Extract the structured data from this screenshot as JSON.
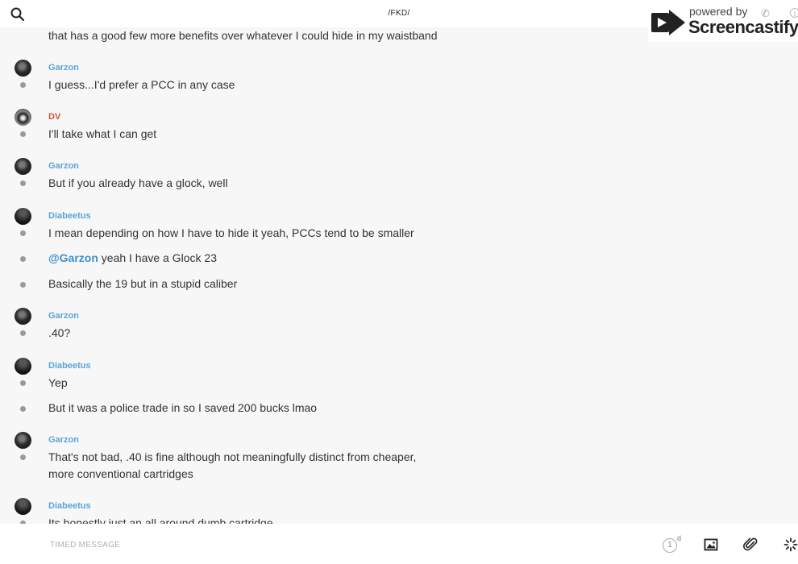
{
  "header": {
    "title": "/FKD/",
    "search_icon": "search-icon"
  },
  "watermark": {
    "powered_by": "powered by",
    "brand": "Screencastify"
  },
  "messages": [
    {
      "author": "",
      "text": "that has a good few more benefits over whatever I could hide in my waistband"
    },
    {
      "author": "Garzon",
      "text": "I guess...I'd prefer a PCC in any case"
    },
    {
      "author": "DV",
      "text": "I'll take what I can get"
    },
    {
      "author": "Garzon",
      "text": "But if you already have a glock, well"
    },
    {
      "author": "Diabeetus",
      "text": "I mean depending on how I have to hide it yeah, PCCs tend to be smaller"
    },
    {
      "author": "",
      "mention": "@Garzon",
      "text": " yeah I have a Glock 23"
    },
    {
      "author": "",
      "text": "Basically the 19 but in a stupid caliber"
    },
    {
      "author": "Garzon",
      "text": ".40?"
    },
    {
      "author": "Diabeetus",
      "text": "Yep"
    },
    {
      "author": "",
      "text": "But it was a police trade in so I saved 200 bucks lmao"
    },
    {
      "author": "Garzon",
      "text": "That's not bad, .40 is fine although not meaningfully distinct from cheaper,",
      "text2": "more conventional cartridges"
    },
    {
      "author": "Diabeetus",
      "text": "Its honestly just an all around dumb cartridge"
    }
  ],
  "composer": {
    "placeholder": "TIMED MESSAGE",
    "timer_value": "1",
    "timer_unit": "d"
  },
  "colors": {
    "author_default": "#5aa6d6",
    "author_dv": "#d0533a",
    "mention": "#3a8fd0"
  }
}
